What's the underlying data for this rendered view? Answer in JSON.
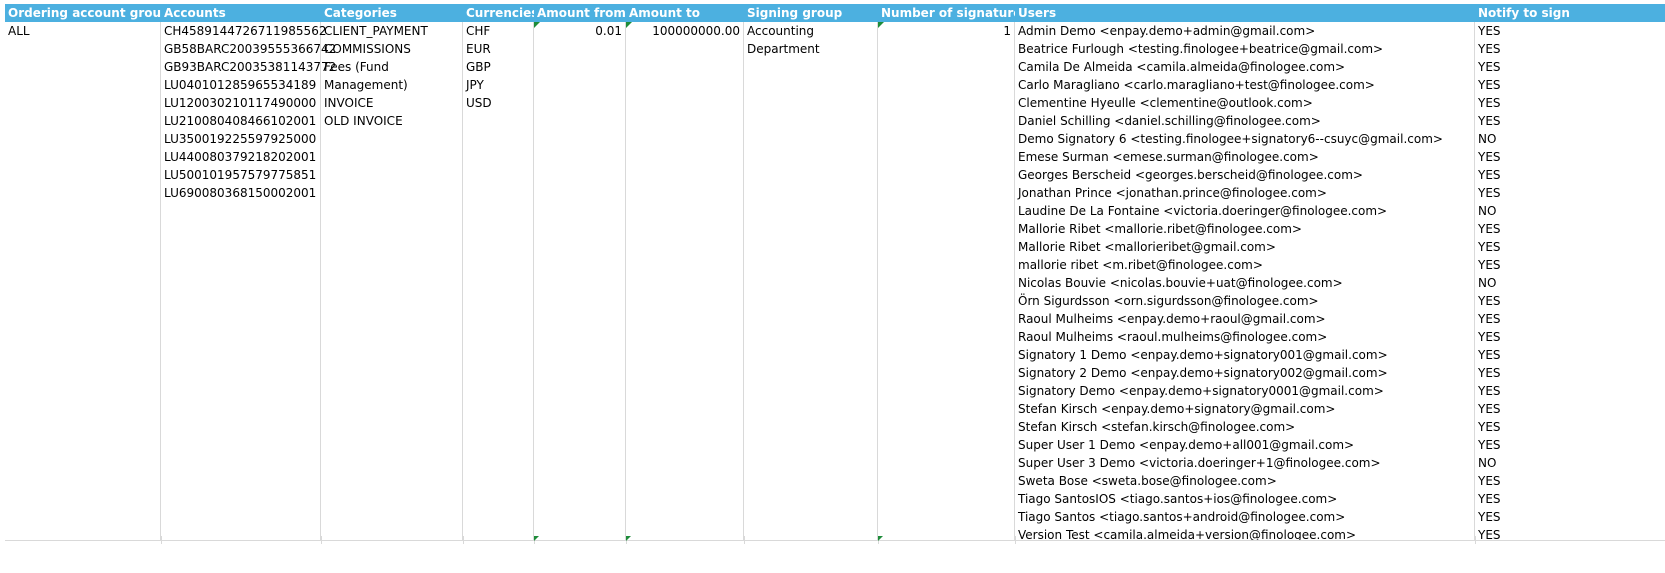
{
  "headers": {
    "ordering_groups": "Ordering account groups",
    "accounts": "Accounts",
    "categories": "Categories",
    "currencies": "Currencies",
    "amount_from": "Amount from",
    "amount_to": "Amount to",
    "signing_group": "Signing group",
    "num_signatures": "Number of signatures",
    "users": "Users",
    "notify": "Notify to sign"
  },
  "row": {
    "ordering_groups": "ALL",
    "accounts": [
      "CH4589144726711985562",
      "GB58BARC20039555366742",
      "GB93BARC20035381143772",
      "LU040101285965534189",
      "LU120030210117490000",
      "LU210080408466102001",
      "LU350019225597925000",
      "LU440080379218202001",
      "LU500101957579775851",
      "LU690080368150002001"
    ],
    "categories": [
      "CLIENT_PAYMENT",
      "COMMISSIONS",
      "Fees (Fund",
      "Management)",
      "INVOICE",
      "OLD INVOICE"
    ],
    "currencies": [
      "CHF",
      "EUR",
      "GBP",
      "JPY",
      "USD"
    ],
    "amount_from": "0.01",
    "amount_to": "100000000.00",
    "signing_group": [
      "Accounting",
      "Department"
    ],
    "num_signatures": "1",
    "users": [
      "Admin Demo <enpay.demo+admin@gmail.com>",
      "Beatrice Furlough <testing.finologee+beatrice@gmail.com>",
      "Camila De Almeida <camila.almeida@finologee.com>",
      "Carlo Maragliano <carlo.maragliano+test@finologee.com>",
      "Clementine Hyeulle <clementine@outlook.com>",
      "Daniel Schilling <daniel.schilling@finologee.com>",
      "Demo Signatory 6 <testing.finologee+signatory6--csuyc@gmail.com>",
      "Emese Surman <emese.surman@finologee.com>",
      "Georges Berscheid <georges.berscheid@finologee.com>",
      "Jonathan Prince <jonathan.prince@finologee.com>",
      "Laudine De La Fontaine <victoria.doeringer@finologee.com>",
      "Mallorie Ribet <mallorie.ribet@finologee.com>",
      "Mallorie Ribet <mallorieribet@gmail.com>",
      "mallorie ribet <m.ribet@finologee.com>",
      "Nicolas Bouvie <nicolas.bouvie+uat@finologee.com>",
      "Örn Sigurdsson <orn.sigurdsson@finologee.com>",
      "Raoul Mulheims <enpay.demo+raoul@gmail.com>",
      "Raoul Mulheims <raoul.mulheims@finologee.com>",
      "Signatory 1 Demo <enpay.demo+signatory001@gmail.com>",
      "Signatory 2 Demo <enpay.demo+signatory002@gmail.com>",
      "Signatory Demo <enpay.demo+signatory0001@gmail.com>",
      "Stefan Kirsch <enpay.demo+signatory@gmail.com>",
      "Stefan Kirsch <stefan.kirsch@finologee.com>",
      "Super User 1 Demo <enpay.demo+all001@gmail.com>",
      "Super User 3 Demo <victoria.doeringer+1@finologee.com>",
      "Sweta Bose <sweta.bose@finologee.com>",
      "Tiago SantosIOS <tiago.santos+ios@finologee.com>",
      "Tiago Santos <tiago.santos+android@finologee.com>",
      "Version Test <camila.almeida+version@finologee.com>"
    ],
    "notify": [
      "YES",
      "YES",
      "YES",
      "YES",
      "YES",
      "YES",
      "NO",
      "YES",
      "YES",
      "YES",
      "NO",
      "YES",
      "YES",
      "YES",
      "NO",
      "YES",
      "YES",
      "YES",
      "YES",
      "YES",
      "YES",
      "YES",
      "YES",
      "YES",
      "NO",
      "YES",
      "YES",
      "YES",
      "YES"
    ]
  },
  "colors": {
    "header_bg": "#4cb0e0",
    "header_text": "#ffffff",
    "grid": "#d9d9d9",
    "comment_marker": "#1e8c3a"
  }
}
